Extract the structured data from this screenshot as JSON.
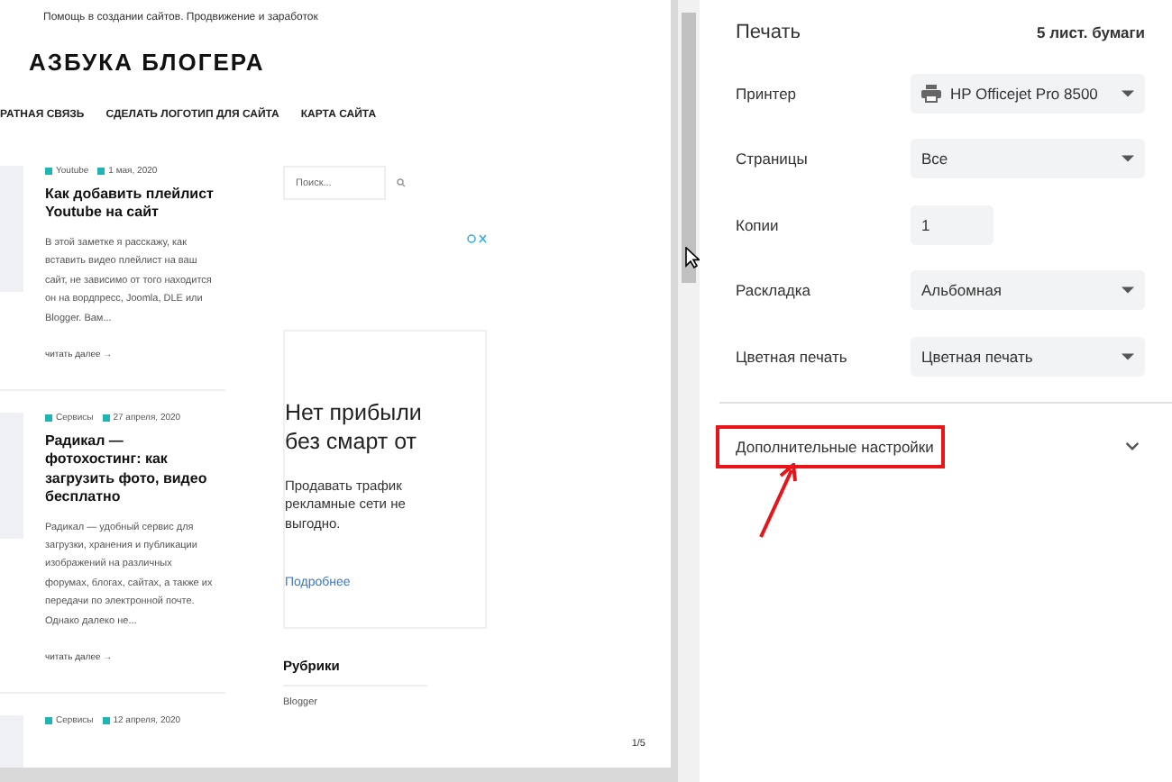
{
  "preview": {
    "tagline": "Помощь в создании сайтов. Продвижение и заработок",
    "site_title": "АЗБУКА БЛОГЕРА",
    "nav": [
      "РАТНАЯ СВЯЗЬ",
      "СДЕЛАТЬ ЛОГОТИП ДЛЯ САЙТА",
      "КАРТА САЙТА"
    ],
    "posts": [
      {
        "category": "Youtube",
        "date": "1 мая, 2020",
        "title": "Как добавить плейлист Youtube на сайт",
        "excerpt": "В этой заметке я расскажу, как вставить видео плейлист на ваш сайт, не зависимо от того находится он на вордпресс, Joomla, DLE или Blogger. Вам...",
        "read_more": "читать далее →"
      },
      {
        "category": "Сервисы",
        "date": "27 апреля, 2020",
        "title": "Радикал — фотохостинг: как загрузить фото, видео бесплатно",
        "excerpt": "Радикал — удобный сервис для загрузки, хранения и публикации изображений на различных форумах, блогах, сайтах, а также их передачи по электронной почте. Однако далеко не...",
        "read_more": "читать далее →"
      },
      {
        "category": "Сервисы",
        "date": "12 апреля, 2020"
      }
    ],
    "search_placeholder": "Поиск...",
    "ad": {
      "headline": "Нет прибыли без смарт от",
      "body": "Продавать трафик рекламные сети не выгодно.",
      "link": "Подробнее"
    },
    "widget_title": "Рубрики",
    "widget_items": [
      "Blogger"
    ],
    "page_number": "1/5"
  },
  "print": {
    "title": "Печать",
    "sheets": "5 лист. бумаги",
    "settings": [
      {
        "label": "Принтер",
        "kind": "select",
        "value": "HP Officejet Pro 8500",
        "printer_icon": true
      },
      {
        "label": "Страницы",
        "kind": "select",
        "value": "Все"
      },
      {
        "label": "Копии",
        "kind": "number",
        "value": "1"
      },
      {
        "label": "Раскладка",
        "kind": "select",
        "value": "Альбомная"
      },
      {
        "label": "Цветная печать",
        "kind": "select",
        "value": "Цветная печать"
      }
    ],
    "more_settings": {
      "label": "Дополнительные настройки",
      "expanded": false,
      "highlighted": true
    }
  }
}
